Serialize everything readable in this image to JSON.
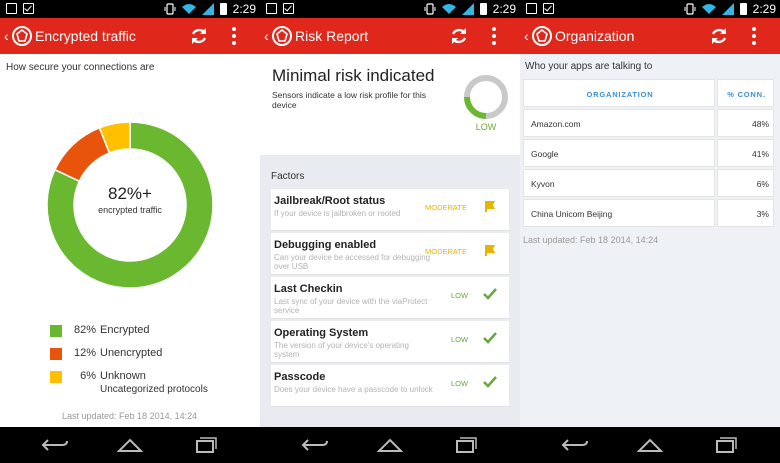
{
  "status": {
    "time": "2:29"
  },
  "colors": {
    "brand_red": "#e0271b",
    "green": "#6ab82f",
    "orange": "#e9540c",
    "yellow": "#ffc000",
    "low": "#6aa73a",
    "moderate": "#e8b400"
  },
  "screen1": {
    "title": "Encrypted traffic",
    "caption": "How secure your connections are",
    "center_value": "82%+",
    "center_label": "encrypted traffic",
    "legend": [
      {
        "pct": "82%",
        "label": "Encrypted",
        "sub": "",
        "color": "#6ab82f"
      },
      {
        "pct": "12%",
        "label": "Unencrypted",
        "sub": "",
        "color": "#e9540c"
      },
      {
        "pct": "6%",
        "label": "Unknown",
        "sub": "Uncategorized protocols",
        "color": "#ffc000"
      }
    ],
    "last_updated": "Last updated: Feb 18 2014, 14:24"
  },
  "chart_data": {
    "type": "pie",
    "categories": [
      "Encrypted",
      "Unencrypted",
      "Unknown"
    ],
    "values": [
      82,
      12,
      6
    ],
    "title": "",
    "legend": "bottom"
  },
  "screen2": {
    "title": "Risk Report",
    "headline": "Minimal risk indicated",
    "subtext": "Sensors indicate a low risk profile for this device",
    "gauge_label": "LOW",
    "factors_heading": "Factors",
    "factors": [
      {
        "name": "Jailbreak/Root status",
        "desc": "If your device is jailbroken or rooted",
        "level": "MODERATE",
        "icon": "flag-icon"
      },
      {
        "name": "Debugging enabled",
        "desc": "Can your device be accessed for debugging over USB",
        "level": "MODERATE",
        "icon": "flag-icon"
      },
      {
        "name": "Last Checkin",
        "desc": "Last sync of your device with the viaProtect service",
        "level": "LOW",
        "icon": "check-icon"
      },
      {
        "name": "Operating System",
        "desc": "The version of your device's operating system",
        "level": "LOW",
        "icon": "check-icon"
      },
      {
        "name": "Passcode",
        "desc": "Does your device have a passcode to unlock",
        "level": "LOW",
        "icon": "check-icon"
      }
    ]
  },
  "screen3": {
    "title": "Organization",
    "caption": "Who your apps are talking to",
    "col_org": "ORGANIZATION",
    "col_conn": "% CONN.",
    "rows": [
      {
        "org": "Amazon.com",
        "conn": "48%"
      },
      {
        "org": "Google",
        "conn": "41%"
      },
      {
        "org": "Kyvon",
        "conn": "6%"
      },
      {
        "org": "China Unicom Beijing",
        "conn": "3%"
      }
    ],
    "last_updated": "Last updated: Feb 18 2014, 14:24"
  }
}
